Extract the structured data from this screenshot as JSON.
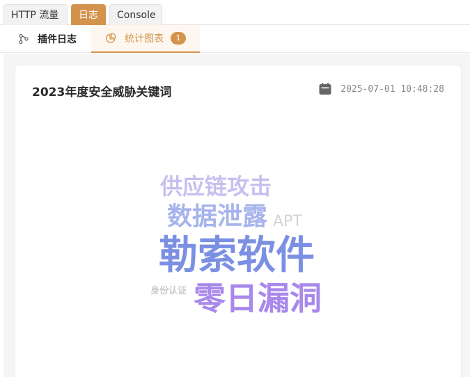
{
  "top_tabs": [
    {
      "label": "HTTP 流量"
    },
    {
      "label": "日志"
    },
    {
      "label": "Console"
    }
  ],
  "sub_tabs": [
    {
      "label": "插件日志",
      "icon": "git-branch-icon"
    },
    {
      "label": "统计图表",
      "icon": "pie-chart-icon",
      "badge": "1"
    }
  ],
  "card": {
    "title": "2023年度安全威胁关键词",
    "timestamp": "2025-07-01 10:48:28",
    "icon": "calendar-icon"
  },
  "word_cloud": {
    "words": [
      {
        "text": "供应链攻击",
        "color": "#c6c0ef"
      },
      {
        "text": "数据泄露",
        "color": "#a6b4ec"
      },
      {
        "text": "APT",
        "color": "#d3d3d3"
      },
      {
        "text": "勒索软件",
        "color": "#7c90e3"
      },
      {
        "text": "身份认证",
        "color": "#c9c9c9"
      },
      {
        "text": "零日漏洞",
        "color": "#a888ea"
      }
    ]
  },
  "colors": {
    "accent": "#d4934b",
    "accent_bg": "#fdf7f0"
  }
}
